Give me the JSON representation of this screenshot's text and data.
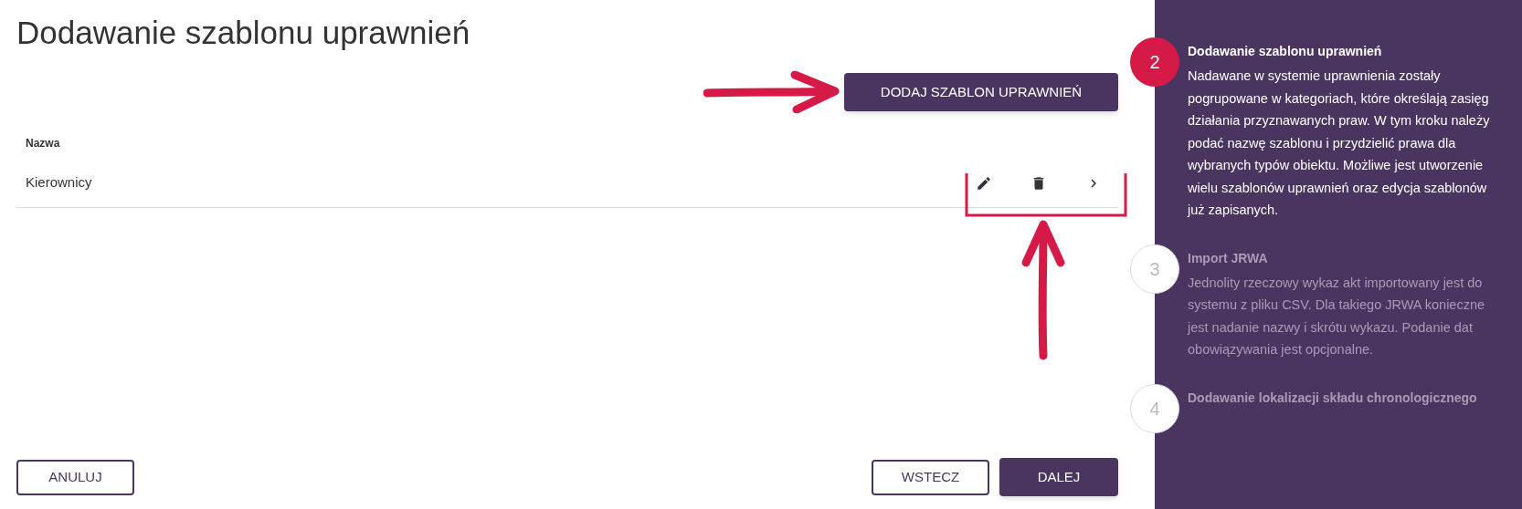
{
  "title": "Dodawanie szablonu uprawnień",
  "add_button": "DODAJ SZABLON UPRAWNIEŃ",
  "table": {
    "columns": [
      "Nazwa"
    ],
    "rows": [
      {
        "name": "Kierownicy"
      }
    ]
  },
  "footer": {
    "cancel": "ANULUJ",
    "back": "WSTECZ",
    "next": "DALEJ"
  },
  "steps": [
    {
      "number": "2",
      "title": "Dodawanie szablonu uprawnień",
      "description": "Nadawane w systemie uprawnienia zostały pogrupowane w kategoriach, które określają zasięg działania przyznawanych praw. W tym kroku należy podać nazwę szablonu i przydzielić prawa dla wybranych typów obiektu. Możliwe jest utworzenie wielu szablonów uprawnień oraz edycja szablonów już zapisanych.",
      "selected": true
    },
    {
      "number": "3",
      "title": "Import JRWA",
      "description": "Jednolity rzeczowy wykaz akt importowany jest do systemu z pliku CSV. Dla takiego JRWA konieczne jest nadanie nazwy i skrótu wykazu. Podanie dat obowiązywania jest opcjonalne.",
      "selected": false
    },
    {
      "number": "4",
      "title": "Dodawanie lokalizacji składu chronologicznego",
      "selected": false
    }
  ]
}
